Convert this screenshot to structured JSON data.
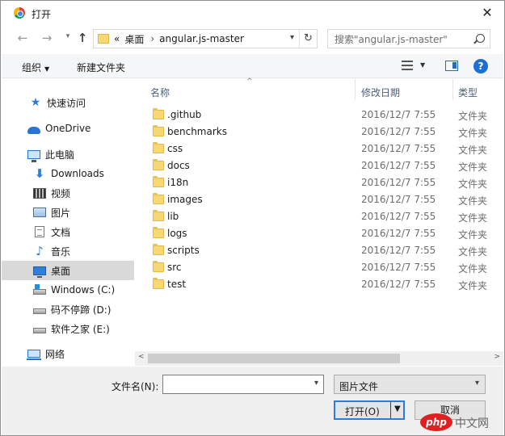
{
  "window": {
    "title": "打开",
    "close_glyph": "✕"
  },
  "nav": {
    "back_glyph": "←",
    "forward_glyph": "→",
    "recent_glyph": "▾",
    "up_glyph": "↑",
    "address": {
      "overflow": "«",
      "parts": [
        "桌面",
        "angular.js-master"
      ],
      "separator": "›",
      "dropdown_glyph": "▾",
      "refresh_glyph": "↻"
    },
    "search_placeholder": "搜索\"angular.js-master\""
  },
  "toolbar": {
    "organize_label": "组织",
    "organize_caret": "▼",
    "new_folder_label": "新建文件夹",
    "view_caret": "▼",
    "help_label": "?"
  },
  "sidebar": {
    "items": [
      {
        "label": "快速访问",
        "icon": "star-icon"
      },
      {
        "label": "OneDrive",
        "icon": "cloud-icon"
      },
      {
        "label": "此电脑",
        "icon": "computer-icon"
      },
      {
        "label": "Downloads",
        "icon": "download-icon"
      },
      {
        "label": "视频",
        "icon": "video-icon"
      },
      {
        "label": "图片",
        "icon": "picture-icon"
      },
      {
        "label": "文档",
        "icon": "document-icon"
      },
      {
        "label": "音乐",
        "icon": "music-icon"
      },
      {
        "label": "桌面",
        "icon": "desktop-icon",
        "selected": true
      },
      {
        "label": "Windows (C:)",
        "icon": "drive-icon"
      },
      {
        "label": "码不停蹄 (D:)",
        "icon": "drive-icon"
      },
      {
        "label": "软件之家 (E:)",
        "icon": "drive-icon"
      },
      {
        "label": "网络",
        "icon": "network-icon"
      }
    ]
  },
  "filelist": {
    "sort_glyph": "^",
    "columns": [
      "名称",
      "修改日期",
      "类型"
    ],
    "rows": [
      {
        "name": ".github",
        "date": "2016/12/7 7:55",
        "type": "文件夹"
      },
      {
        "name": "benchmarks",
        "date": "2016/12/7 7:55",
        "type": "文件夹"
      },
      {
        "name": "css",
        "date": "2016/12/7 7:55",
        "type": "文件夹"
      },
      {
        "name": "docs",
        "date": "2016/12/7 7:55",
        "type": "文件夹"
      },
      {
        "name": "i18n",
        "date": "2016/12/7 7:55",
        "type": "文件夹"
      },
      {
        "name": "images",
        "date": "2016/12/7 7:55",
        "type": "文件夹"
      },
      {
        "name": "lib",
        "date": "2016/12/7 7:55",
        "type": "文件夹"
      },
      {
        "name": "logs",
        "date": "2016/12/7 7:55",
        "type": "文件夹"
      },
      {
        "name": "scripts",
        "date": "2016/12/7 7:55",
        "type": "文件夹"
      },
      {
        "name": "src",
        "date": "2016/12/7 7:55",
        "type": "文件夹"
      },
      {
        "name": "test",
        "date": "2016/12/7 7:55",
        "type": "文件夹"
      }
    ]
  },
  "scrollbar": {
    "left_glyph": "<",
    "right_glyph": ">"
  },
  "bottom": {
    "filename_label": "文件名(N):",
    "filename_value": "",
    "dropdown_glyph": "▾",
    "filetype_value": "图片文件",
    "open_label": "打开(O)",
    "open_caret": "▼",
    "cancel_label": "取消"
  },
  "watermark": {
    "logo": "php",
    "text": "中文网"
  },
  "colors": {
    "accent": "#2e7cd6",
    "folder": "#f8d775",
    "selected": "#d9d9d9"
  }
}
